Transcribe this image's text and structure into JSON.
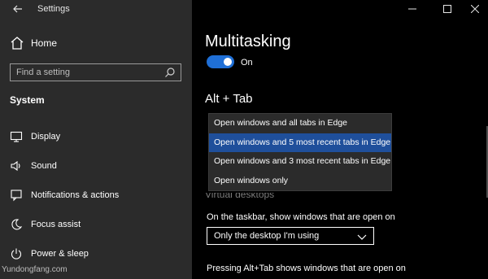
{
  "window": {
    "title": "Settings"
  },
  "sidebar": {
    "home_label": "Home",
    "search_placeholder": "Find a setting",
    "section_heading": "System",
    "items": [
      {
        "label": "Display",
        "icon": "monitor-icon"
      },
      {
        "label": "Sound",
        "icon": "speaker-icon"
      },
      {
        "label": "Notifications & actions",
        "icon": "notifications-icon"
      },
      {
        "label": "Focus assist",
        "icon": "moon-icon"
      },
      {
        "label": "Power & sleep",
        "icon": "power-icon"
      }
    ]
  },
  "watermark": "Yundongfang.com",
  "main": {
    "title": "Multitasking",
    "toggle": {
      "label": "On",
      "checked": true
    },
    "alt_tab": {
      "title": "Alt + Tab",
      "options": [
        "Open windows and all tabs in Edge",
        "Open windows and 5 most recent tabs in Edge",
        "Open windows and 3 most recent tabs in Edge",
        "Open windows only"
      ],
      "selected_index": 1
    },
    "virtual_desktops": {
      "title": "Virtual desktops",
      "taskbar_label": "On the taskbar, show windows that are open on",
      "taskbar_value": "Only the desktop I'm using",
      "alt_tab_label": "Pressing Alt+Tab shows windows that are open on"
    }
  },
  "colors": {
    "accent": "#1f6fd6",
    "selected": "#1f4f9b",
    "sidebar_bg": "#2b2b2b",
    "main_bg": "#000000"
  }
}
